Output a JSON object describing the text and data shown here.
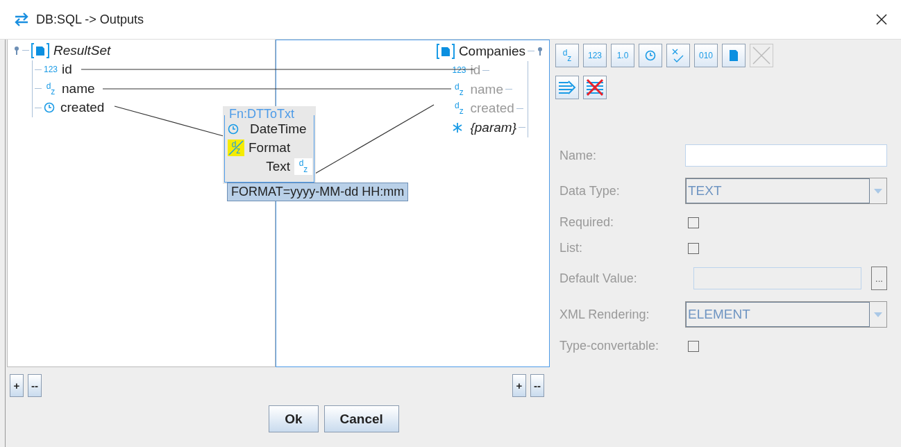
{
  "window": {
    "title": "DB:SQL -> Outputs"
  },
  "source": {
    "name": "ResultSet",
    "fields": [
      {
        "name": "id",
        "kind": "integer",
        "glyph": "123"
      },
      {
        "name": "name",
        "kind": "text",
        "glyph": "$^{d}$$_{z}$"
      },
      {
        "name": "created",
        "kind": "datetime"
      }
    ]
  },
  "target": {
    "name": "Companies",
    "fields": [
      {
        "name": "id",
        "kind": "integer",
        "glyph": "123",
        "mapped": true
      },
      {
        "name": "name",
        "kind": "text",
        "glyph": "$^{d}$$_{z}$",
        "mapped": true
      },
      {
        "name": "created",
        "kind": "text",
        "glyph": "$^{d}$$_{z}$",
        "mapped": true
      },
      {
        "name": "{param}",
        "kind": "param",
        "mapped": false
      }
    ]
  },
  "function": {
    "title": "Fn:DTToTxt",
    "inputs": [
      {
        "name": "DateTime",
        "kind": "datetime"
      },
      {
        "name": "Format",
        "kind": "constant",
        "glyph": "$^{d}$$_{z}$"
      }
    ],
    "output": {
      "name": "Text",
      "kind": "text",
      "glyph": "$^{d}$$_{z}$"
    }
  },
  "tooltip": "FORMAT=yyyy-MM-dd HH:mm",
  "source_buttons": [
    "+",
    "--"
  ],
  "target_buttons": [
    "+",
    "--"
  ],
  "toolbar": [
    [
      {
        "kind": "glyph",
        "glyph": "$^{d}$$_{z}$",
        "disabled": false
      },
      {
        "kind": "glyph",
        "glyph": "123",
        "disabled": false
      },
      {
        "kind": "glyph",
        "glyph": "1.0",
        "disabled": false
      },
      {
        "kind": "clock",
        "disabled": false
      },
      {
        "kind": "check",
        "disabled": false
      },
      {
        "kind": "glyph",
        "glyph": "010",
        "disabled": false
      },
      {
        "kind": "record",
        "disabled": false
      },
      {
        "kind": "close",
        "disabled": true
      }
    ],
    [
      {
        "kind": "map",
        "disabled": false
      },
      {
        "kind": "unmap",
        "disabled": false
      }
    ]
  ],
  "form": [
    {
      "label": "Name:",
      "kind": "input",
      "disabled": false
    },
    {
      "label": "Data Type:",
      "kind": "select",
      "value": "TEXT",
      "disabled": true
    },
    {
      "label": "Required:",
      "kind": "checkbox",
      "checked": false
    },
    {
      "label": "List:",
      "kind": "checkbox",
      "checked": false
    },
    {
      "label": "Default Value:",
      "kind": "input-button",
      "disabled": true,
      "button": "..."
    },
    {
      "label": "XML Rendering:",
      "kind": "select",
      "value": "ELEMENT",
      "disabled": true
    },
    {
      "label": "Type-convertable:",
      "kind": "checkbox",
      "checked": false
    }
  ],
  "buttons": [
    "Ok",
    "Cancel"
  ]
}
